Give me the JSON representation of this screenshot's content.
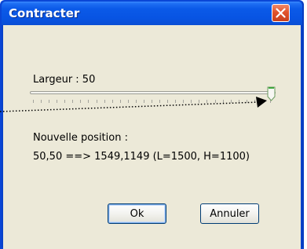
{
  "window": {
    "title": "Contracter",
    "close_icon": "close-icon"
  },
  "width": {
    "label": "Largeur : 50",
    "slider_value_fraction": 1.0,
    "tick_count": 31
  },
  "position": {
    "heading": "Nouvelle position :",
    "detail": "50,50 ==> 1549,1149 (L=1500, H=1100)"
  },
  "buttons": {
    "ok_label": "Ok",
    "cancel_label": "Annuler"
  },
  "colors": {
    "title_bar": "#0854e3",
    "client_bg": "#ece9d8",
    "close_button": "#e0532c",
    "thumb_accent": "#21a121"
  }
}
